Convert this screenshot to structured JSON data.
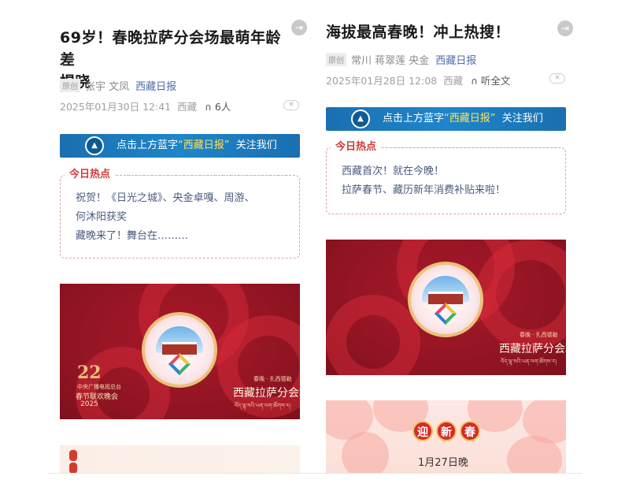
{
  "left": {
    "title_line1": "69岁！春晚拉萨分会场最萌年龄差",
    "title_line2": "揭晓",
    "original_tag": "原创",
    "authors": "张宇 文凤",
    "source": "西藏日报",
    "date": "2025年01月30日 12:41",
    "location": "西藏",
    "listeners": "6人",
    "follow_prefix": "点击上方蓝字",
    "follow_highlight": "“西藏日报”",
    "follow_suffix": "关注我们",
    "hot_title": "今日热点",
    "hot_items": [
      "祝贺！《日光之城》、央金卓嘎、周游、",
      "何沐阳获奖",
      "藏晚来了！舞台在………"
    ],
    "banner": {
      "logo": "22",
      "small_text": "中央广播电视总台",
      "gala": "春节联欢晚会",
      "year": "2025",
      "sponsor": "春晚 · 扎西德勒",
      "main": "西藏拉萨分会场",
      "tibetan": "བོད་ལྷ་སའི་ཡན་ལག་ཚོགས་ར།"
    }
  },
  "right": {
    "title": "海拔最高春晚！冲上热搜！",
    "original_tag": "原创",
    "authors": "常川 蒋翠莲 央金",
    "source": "西藏日报",
    "date": "2025年01月28日 12:08",
    "location": "西藏",
    "listen_label": "听全文",
    "follow_prefix": "点击上方蓝字",
    "follow_highlight": "“西藏日报”",
    "follow_suffix": "关注我们",
    "hot_title": "今日热点",
    "hot_items": [
      "西藏首次！就在今晚！",
      "拉萨春节、藏历新年消费补贴来啦！"
    ],
    "banner": {
      "sponsor": "春晚 · 扎西德勒",
      "main": "西藏拉萨分会场",
      "tibetan": "བོད་ལྷ་སའི་ཡན་ལག་ཚོགས་ར།"
    },
    "newyear": {
      "chars": [
        "迎",
        "新",
        "春"
      ],
      "date": "1月27日晚"
    }
  },
  "colors": {
    "accent_red": "#d23a3a",
    "follow_blue": "#1a6fb0",
    "banner_red": "#8f1422",
    "source_blue": "#4a6ea8"
  },
  "icons": [
    "exit-icon",
    "headphone-icon",
    "close-icon",
    "logo-icon"
  ]
}
